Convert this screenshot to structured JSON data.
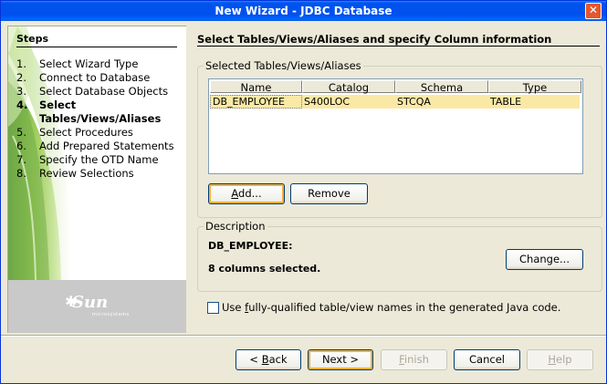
{
  "window": {
    "title": "New Wizard - JDBC Database",
    "close_icon": "close-icon"
  },
  "steps": {
    "title": "Steps",
    "items": [
      {
        "num": "1.",
        "label": "Select Wizard Type"
      },
      {
        "num": "2.",
        "label": "Connect to Database"
      },
      {
        "num": "3.",
        "label": "Select Database Objects"
      },
      {
        "num": "4.",
        "label": "Select Tables/Views/Aliases"
      },
      {
        "num": "5.",
        "label": "Select Procedures"
      },
      {
        "num": "6.",
        "label": "Add Prepared Statements"
      },
      {
        "num": "7.",
        "label": "Specify the OTD Name"
      },
      {
        "num": "8.",
        "label": "Review Selections"
      }
    ],
    "current_index": 3,
    "logo": "Sun",
    "logo_sub": "microsystems"
  },
  "main": {
    "title": "Select Tables/Views/Aliases and specify Column information",
    "selected_group": {
      "legend": "Selected Tables/Views/Aliases",
      "columns": [
        "Name",
        "Catalog",
        "Schema",
        "Type"
      ],
      "rows": [
        [
          "DB_EMPLOYEE",
          "S400LOC",
          "STCQA",
          "TABLE"
        ]
      ],
      "add_button": {
        "pre": "",
        "u": "A",
        "post": "dd..."
      },
      "remove_button": "Remove"
    },
    "description_group": {
      "legend": "Description",
      "name": "DB_EMPLOYEE:",
      "columns_selected": "8 columns selected.",
      "change_button": "Change..."
    },
    "checkbox": {
      "pre": "Use ",
      "u": "f",
      "post": "ully-qualified table/view names in the generated Java code.",
      "checked": false
    }
  },
  "footer": {
    "back": {
      "pre": "< ",
      "u": "B",
      "post": "ack"
    },
    "next": "Next >",
    "finish": {
      "u": "F",
      "post": "inish"
    },
    "cancel": "Cancel",
    "help": {
      "u": "H",
      "post": "elp"
    }
  }
}
